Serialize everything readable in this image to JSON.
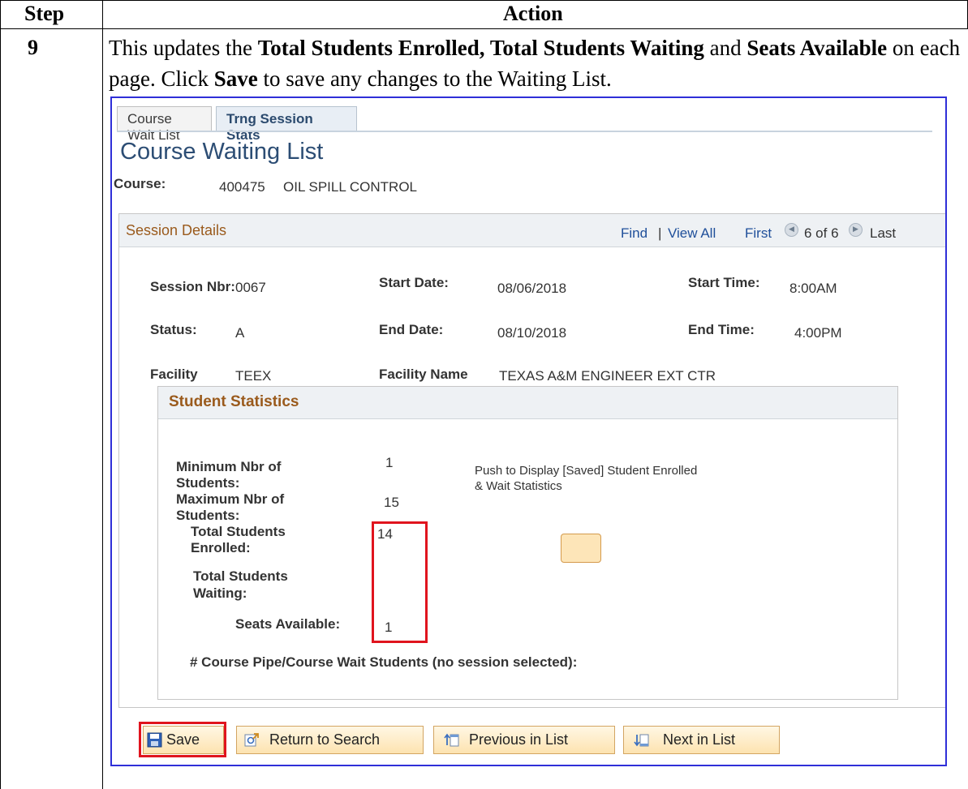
{
  "step_table": {
    "header_step": "Step",
    "header_action": "Action",
    "step_number": "9",
    "instruction": {
      "part1": "This updates the ",
      "bold1": "Total Students Enrolled, Total Students Waiting",
      "part2": " and ",
      "bold2": "Seats Available",
      "part3": " on each page. Click ",
      "bold3": "Save",
      "part4": " to save any changes to the Waiting List."
    }
  },
  "tabs": [
    {
      "label": "Course Wait List",
      "active": false
    },
    {
      "label": "Trng Session Stats",
      "active": true
    }
  ],
  "page_title": "Course Waiting List",
  "course": {
    "label": "Course:",
    "number": "400475",
    "name": "OIL SPILL CONTROL"
  },
  "session_details": {
    "title": "Session Details",
    "find": "Find",
    "separator": "|",
    "view_all": "View All",
    "first": "First",
    "counter": "6 of 6",
    "last": "Last",
    "fields": {
      "session_nbr_label": "Session Nbr:",
      "session_nbr": "0067",
      "start_date_label": "Start Date:",
      "start_date": "08/06/2018",
      "start_time_label": "Start Time:",
      "start_time": "8:00AM",
      "status_label": "Status:",
      "status": "A",
      "end_date_label": "End Date:",
      "end_date": "08/10/2018",
      "end_time_label": "End Time:",
      "end_time": "4:00PM",
      "facility_label": "Facility",
      "facility": "TEEX",
      "facility_name_label": "Facility Name",
      "facility_name": "TEXAS A&M ENGINEER EXT CTR"
    }
  },
  "student_statistics": {
    "title": "Student Statistics",
    "min_label_1": "Minimum Nbr of",
    "min_label_2": "Students:",
    "min_value": "1",
    "max_label_1": "Maximum Nbr of",
    "max_label_2": "Students:",
    "max_value": "15",
    "enrolled_label_1": "Total Students",
    "enrolled_label_2": "Enrolled:",
    "enrolled_value": "14",
    "waiting_label_1": "Total Students",
    "waiting_label_2": "Waiting:",
    "waiting_value": "",
    "seats_label": "Seats Available:",
    "seats_value": "1",
    "push_text_1": "Push to Display [Saved] Student Enrolled",
    "push_text_2": "& Wait Statistics",
    "pipe_label": "# Course Pipe/Course Wait Students (no session selected):"
  },
  "toolbar": {
    "save": "Save",
    "return_to_search": "Return to Search",
    "previous_in_list": "Previous in List",
    "next_in_list": "Next in List"
  },
  "colors": {
    "highlight_red": "#e0141e",
    "frame_blue": "#2f2fd8",
    "section_title": "#9a5a1c",
    "link_blue": "#1f4f9a"
  }
}
